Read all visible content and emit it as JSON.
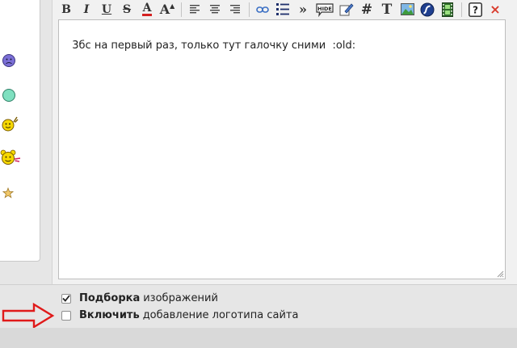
{
  "toolbar": {
    "buttons": [
      {
        "name": "bold-button",
        "glyph": "B"
      },
      {
        "name": "italic-button",
        "glyph": "I"
      },
      {
        "name": "underline-button",
        "glyph": "U"
      },
      {
        "name": "strikethrough-button",
        "glyph": "S"
      },
      {
        "name": "font-color-button",
        "glyph": "A"
      },
      {
        "name": "font-size-button",
        "glyph": "A"
      }
    ],
    "hide_label": "HIDE",
    "hash_label": "#",
    "quote_label": "»",
    "text_label": "T",
    "help_label": "?",
    "close_label": "×"
  },
  "editor": {
    "text": "3бс на первый раз, только тут галочку сними  :old:"
  },
  "options": {
    "gallery_bold": "Подборка",
    "gallery_rest": "изображений",
    "gallery_checked": true,
    "logo_bold": "Включить",
    "logo_rest": "добавление логотипа сайта",
    "logo_checked": false
  },
  "colors": {
    "arrow": "#e01a1a",
    "close": "#d93a2b",
    "link_blue": "#3a6fc4"
  }
}
